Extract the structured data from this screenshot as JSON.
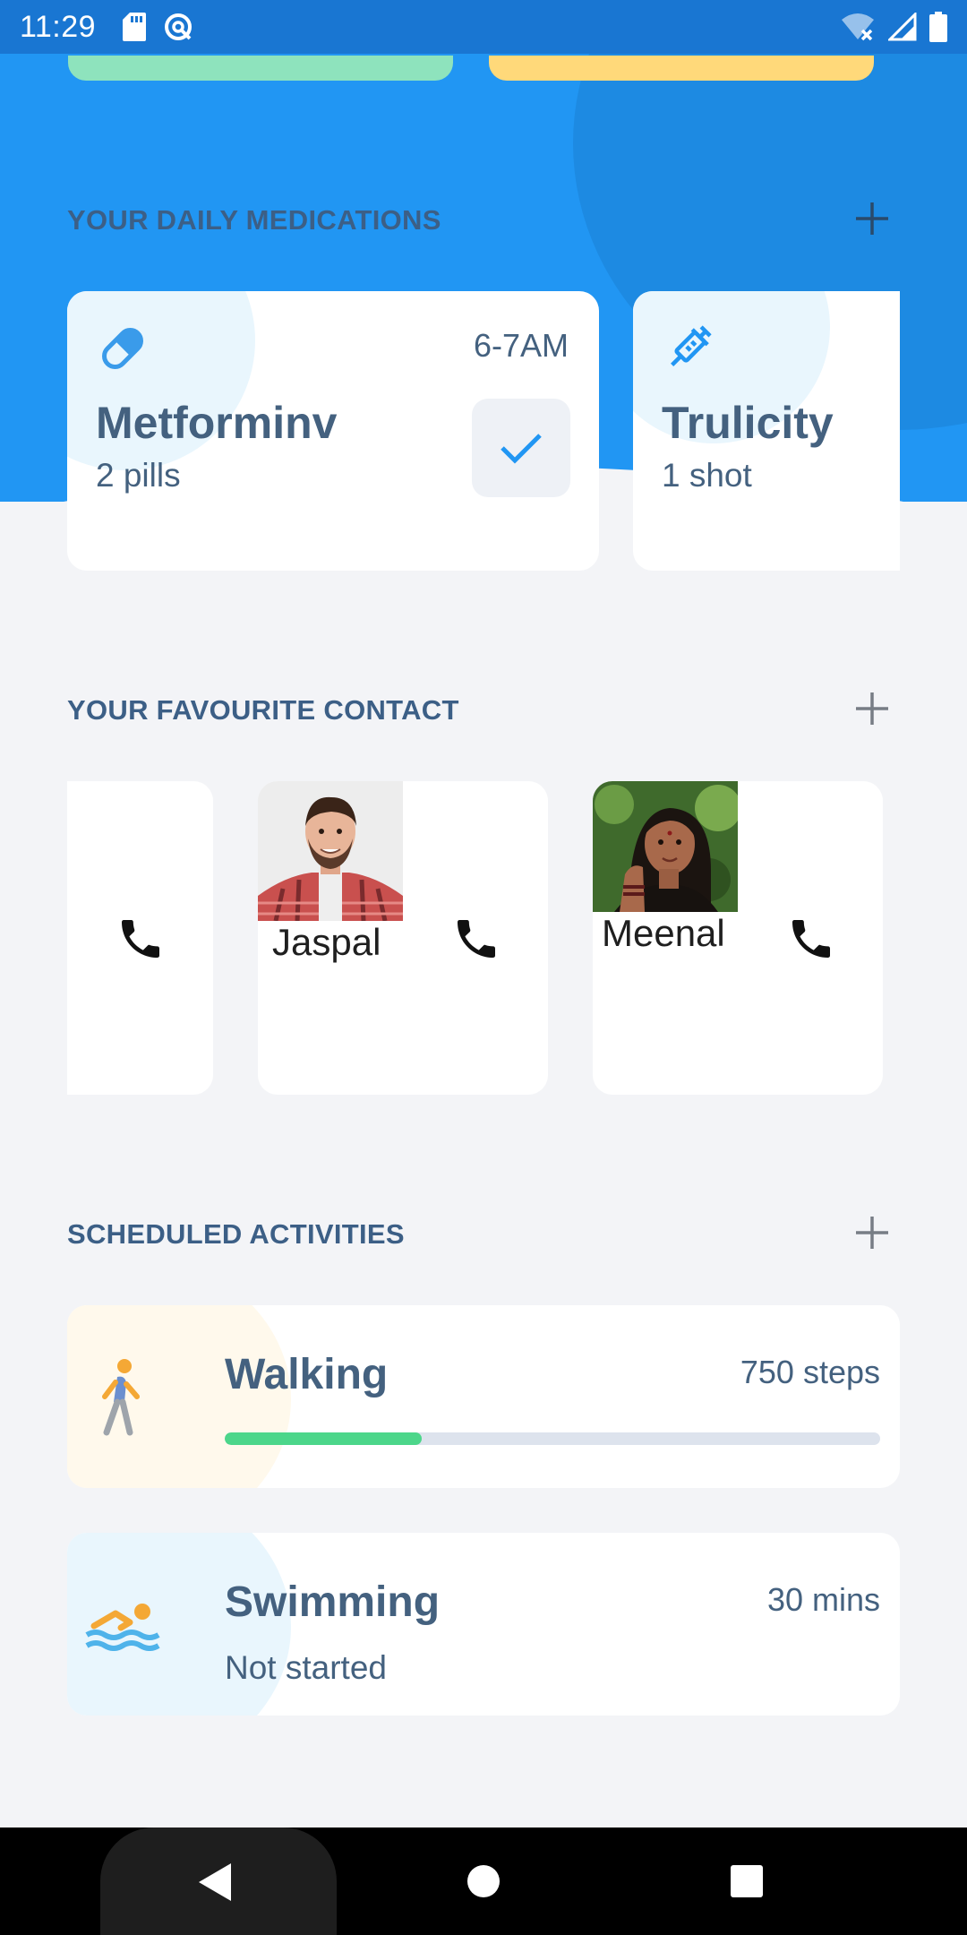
{
  "status_bar": {
    "time": "11:29",
    "left_icons": [
      "sd-card-icon",
      "sync-disabled-icon"
    ],
    "right_icons": [
      "wifi-off-icon",
      "signal-icon",
      "battery-icon"
    ]
  },
  "colors": {
    "hero_blue": "#2196f3",
    "status_bar": "#1976d2",
    "accent_blue": "#2196f3",
    "text_slate": "#44617f",
    "progress_green": "#4cd68a",
    "background": "#f3f4f7"
  },
  "medications": {
    "title": "YOUR DAILY MEDICATIONS",
    "add_icon": "plus-icon",
    "items": [
      {
        "name": "Metforminv",
        "dose": "2 pills",
        "time": "6-7AM",
        "icon": "pill-icon",
        "action_icon": "check-icon"
      },
      {
        "name": "Trulicity",
        "dose": "1 shot",
        "time": "",
        "icon": "syringe-icon"
      }
    ]
  },
  "contacts": {
    "title": "YOUR FAVOURITE CONTACT",
    "add_icon": "plus-icon",
    "items": [
      {
        "name": "",
        "call_icon": "phone-icon"
      },
      {
        "name": "Jaspal",
        "call_icon": "phone-icon"
      },
      {
        "name": "Meenal",
        "call_icon": "phone-icon"
      }
    ]
  },
  "activities": {
    "title": "SCHEDULED ACTIVITIES",
    "add_icon": "plus-icon",
    "items": [
      {
        "name": "Walking",
        "metric": "750 steps",
        "progress": 0.3,
        "icon": "walking-icon",
        "status": ""
      },
      {
        "name": "Swimming",
        "metric": "30 mins",
        "status": "Not started",
        "icon": "swimming-icon"
      }
    ]
  },
  "nav": {
    "back_icon": "back-icon",
    "home_icon": "home-icon",
    "recents_icon": "recents-icon"
  }
}
